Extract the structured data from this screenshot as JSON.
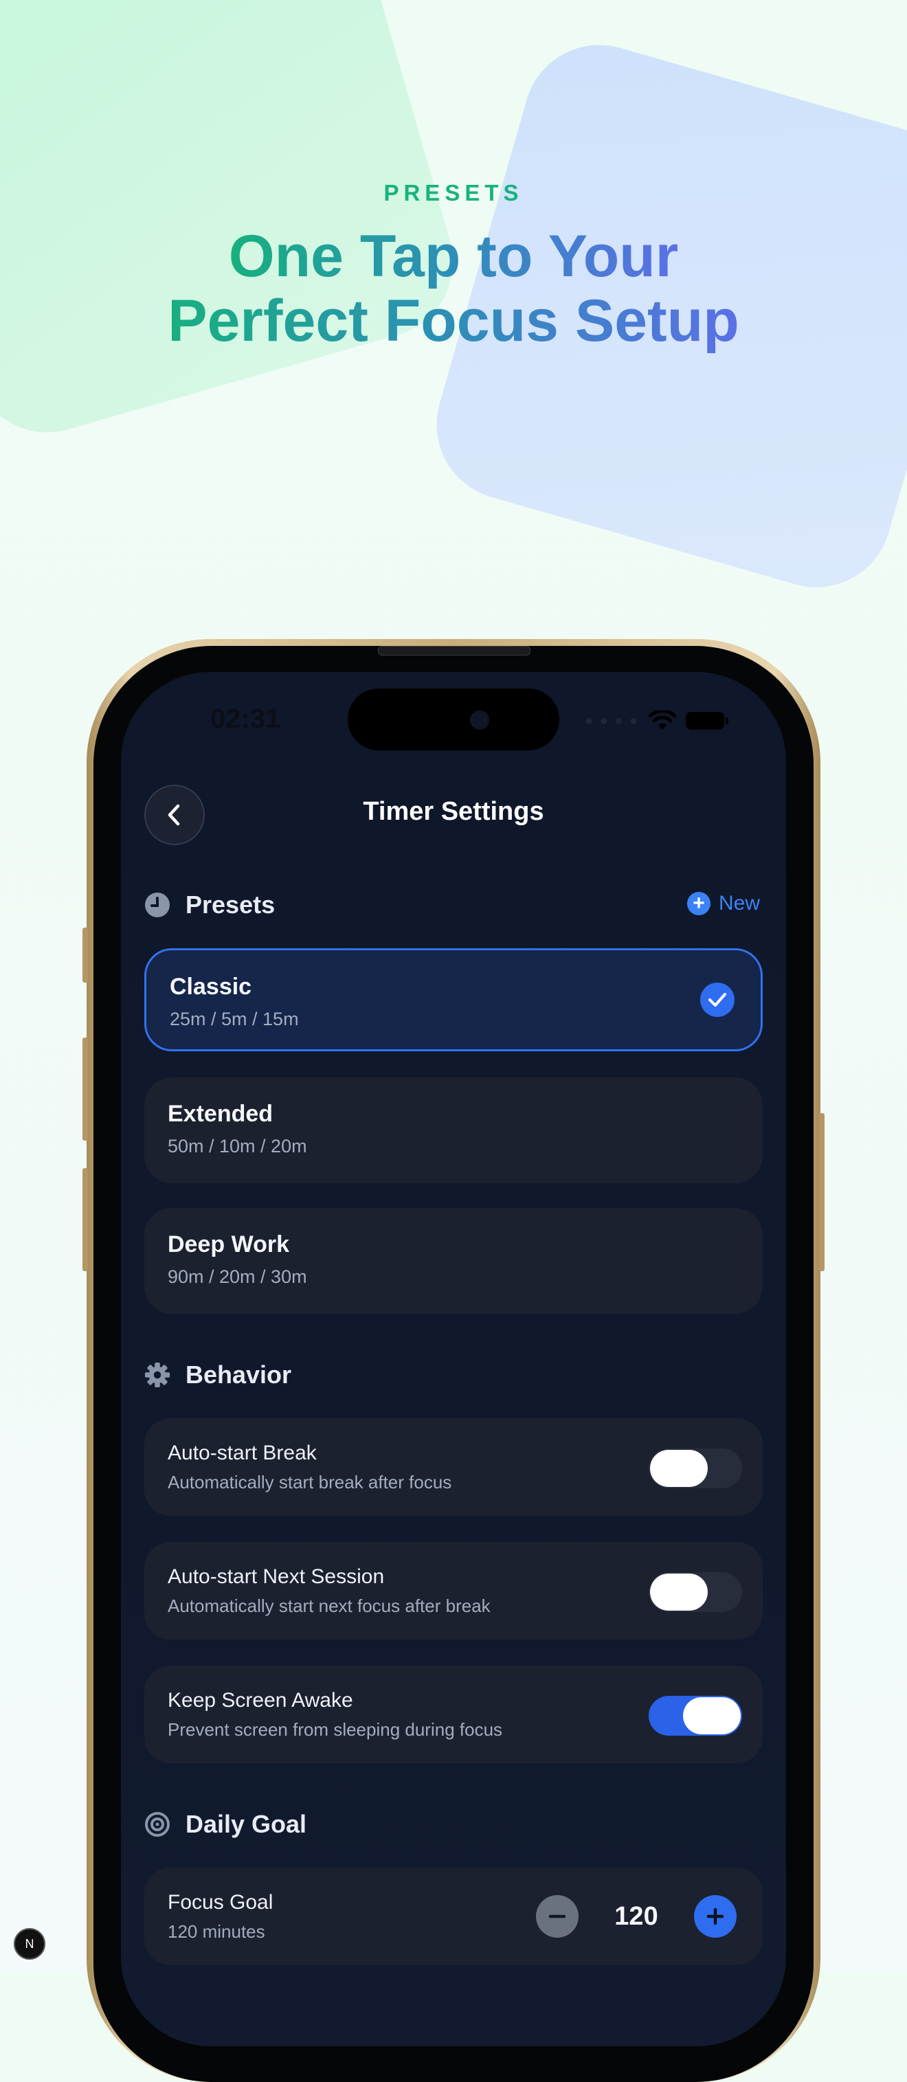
{
  "hero": {
    "eyebrow": "PRESETS",
    "headline_line1": "One Tap to Your",
    "headline_line2": "Perfect Focus Setup"
  },
  "status_bar": {
    "time": "02:31",
    "icons": [
      "wifi-icon",
      "battery-icon"
    ]
  },
  "nav": {
    "title": "Timer Settings",
    "back_icon": "chevron-left-icon"
  },
  "presets": {
    "heading": "Presets",
    "icon": "clock-icon",
    "new_label": "New",
    "items": [
      {
        "name": "Classic",
        "meta": "25m / 5m / 15m",
        "selected": true
      },
      {
        "name": "Extended",
        "meta": "50m / 10m / 20m",
        "selected": false
      },
      {
        "name": "Deep Work",
        "meta": "90m / 20m / 30m",
        "selected": false
      }
    ]
  },
  "behavior": {
    "heading": "Behavior",
    "icon": "gear-icon",
    "rows": [
      {
        "title": "Auto-start Break",
        "subtitle": "Automatically start break after focus",
        "enabled": false
      },
      {
        "title": "Auto-start Next Session",
        "subtitle": "Automatically start next focus after break",
        "enabled": false
      },
      {
        "title": "Keep Screen Awake",
        "subtitle": "Prevent screen from sleeping during focus",
        "enabled": true
      }
    ]
  },
  "daily_goal": {
    "heading": "Daily Goal",
    "icon": "target-icon",
    "focus_goal_title": "Focus Goal",
    "focus_goal_subtitle": "120 minutes",
    "value": "120"
  },
  "colors": {
    "accent_blue": "#2f6df0",
    "eyebrow_green": "#19b27e",
    "screen_bg": "#0f172a",
    "card_bg": "#1c2130"
  },
  "corner_badge": "N"
}
